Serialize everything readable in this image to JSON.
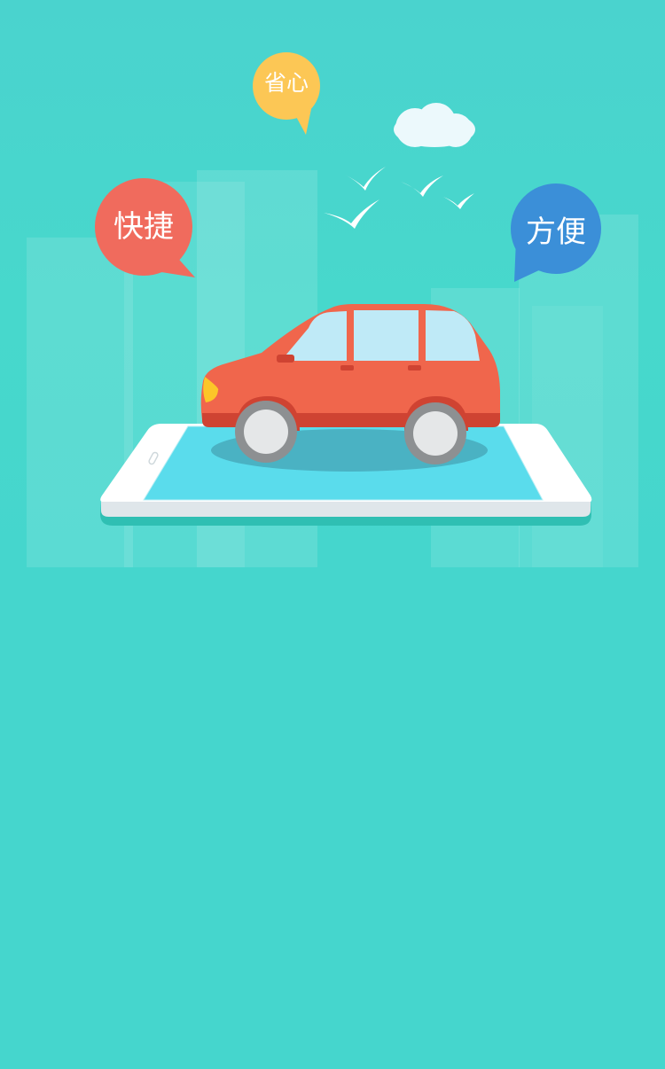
{
  "screen": {
    "background_color": "#45d6cd"
  },
  "illustration": {
    "bubbles": [
      {
        "text": "快捷",
        "color": "#f06b5d",
        "icon": "speech-bubble"
      },
      {
        "text": "省心",
        "color": "#fcc755",
        "icon": "speech-bubble"
      },
      {
        "text": "方便",
        "color": "#3b8fd8",
        "icon": "speech-bubble"
      }
    ],
    "car_color": "#f0664c",
    "phone_screen_color": "#5adcec",
    "icons": [
      "cloud-icon",
      "bird-icon",
      "car-icon",
      "phone-icon",
      "city-buildings"
    ]
  }
}
